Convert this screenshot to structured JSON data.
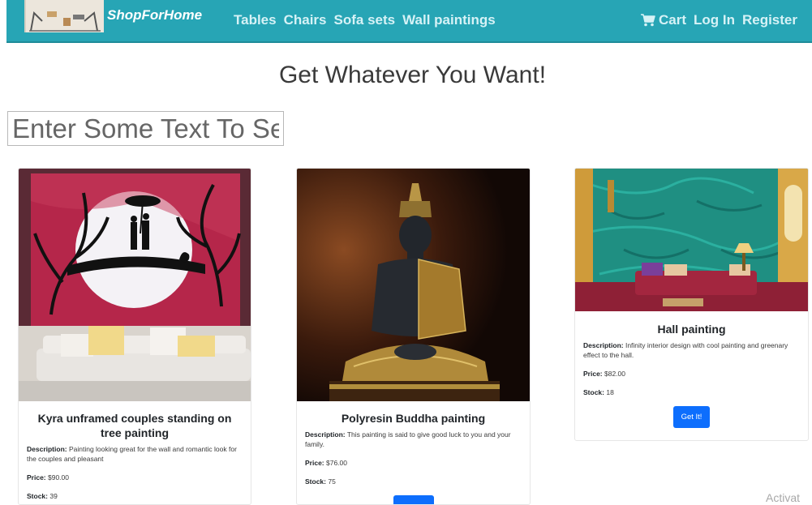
{
  "navbar": {
    "brand": "ShopForHome",
    "links": [
      "Tables",
      "Chairs",
      "Sofa sets",
      "Wall paintings"
    ],
    "cart": "Cart",
    "login": "Log In",
    "register": "Register",
    "color": "#27a5b5"
  },
  "heading": "Get Whatever You Want!",
  "search": {
    "placeholder": "Enter Some Text To Search"
  },
  "labels": {
    "description": "Description:",
    "price": "Price:",
    "stock": "Stock:"
  },
  "products": [
    {
      "title": "Kyra unframed couples standing on tree painting",
      "description": "Painting looking great for the wall and romantic look for the couples and pleasant",
      "price": "$90.00",
      "stock": "39",
      "button": ""
    },
    {
      "title": "Polyresin Buddha painting",
      "description": "This painting is said to give good luck to you and your family.",
      "price": "$76.00",
      "stock": "75",
      "button": ""
    },
    {
      "title": "Hall painting",
      "description": "Infinity interior design with cool painting and greenary effect to the hall.",
      "price": "$82.00",
      "stock": "18",
      "button": "Get It!"
    }
  ],
  "watermark": "Activat"
}
